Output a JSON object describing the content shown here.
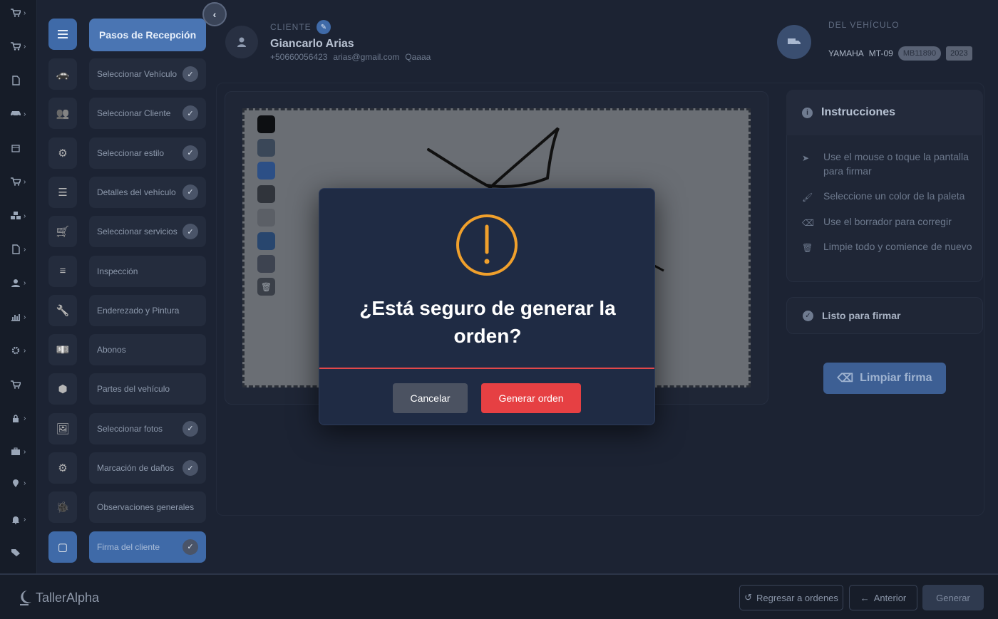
{
  "steps": {
    "header": "Pasos de Recepción",
    "items": [
      {
        "label": "Seleccionar Vehículo",
        "done": true
      },
      {
        "label": "Seleccionar Cliente",
        "done": true
      },
      {
        "label": "Seleccionar estilo",
        "done": true
      },
      {
        "label": "Detalles del vehículo",
        "done": true
      },
      {
        "label": "Seleccionar servicios",
        "done": true
      },
      {
        "label": "Inspección",
        "done": false
      },
      {
        "label": "Enderezado y Pintura",
        "done": false
      },
      {
        "label": "Abonos",
        "done": false
      },
      {
        "label": "Partes del vehículo",
        "done": false
      },
      {
        "label": "Seleccionar fotos",
        "done": true
      },
      {
        "label": "Marcación de daños",
        "done": true
      },
      {
        "label": "Observaciones generales",
        "done": false
      },
      {
        "label": "Firma del cliente",
        "done": true
      }
    ]
  },
  "client": {
    "label": "CLIENTE",
    "name": "Giancarlo Arias",
    "phone": "+50660056423",
    "email": "arias@gmail.com",
    "extra": "Qaaaa"
  },
  "vehicle": {
    "label": "DEL VEHÍCULO",
    "brand": "YAMAHA",
    "model": "MT-09",
    "plate": "MB11890",
    "year": "2023"
  },
  "palette": [
    "#0d0f12",
    "#3a4758",
    "#2c4f86",
    "#30343b",
    "#5b5f66",
    "#28466e",
    "#3d4350"
  ],
  "instructions": {
    "title": "Instrucciones",
    "items": [
      {
        "icon": "pointer-icon",
        "text": "Use el mouse o toque la pantalla para firmar"
      },
      {
        "icon": "brush-icon",
        "text": "Seleccione un color de la paleta"
      },
      {
        "icon": "eraser-icon",
        "text": "Use el borrador para corregir"
      },
      {
        "icon": "trash-icon",
        "text": "Limpie todo y comience de nuevo"
      }
    ]
  },
  "ready": {
    "label": "Listo para firmar"
  },
  "clear_button": "Limpiar firma",
  "footer": {
    "brand": "TallerAlpha",
    "back_to_orders": "Regresar a ordenes",
    "previous": "Anterior",
    "generate": "Generar"
  },
  "modal": {
    "title": "¿Está seguro de generar la orden?",
    "cancel": "Cancelar",
    "confirm": "Generar orden",
    "colors": {
      "warning": "#f0a02c",
      "confirm": "#e64043",
      "divider": "#e2484a"
    }
  }
}
